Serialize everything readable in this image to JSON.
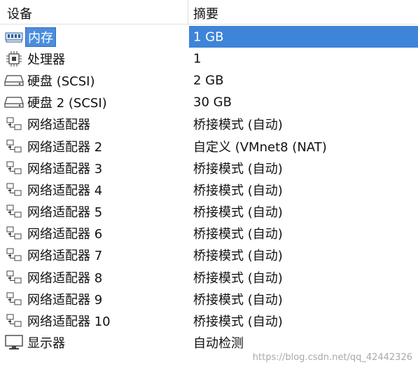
{
  "header": {
    "device_col": "设备",
    "summary_col": "摘要"
  },
  "devices": [
    {
      "icon": "memory-icon",
      "label": "内存",
      "summary": "1 GB",
      "selected": true
    },
    {
      "icon": "processor-icon",
      "label": "处理器",
      "summary": "1"
    },
    {
      "icon": "hard-disk-icon",
      "label": "硬盘 (SCSI)",
      "summary": "2 GB"
    },
    {
      "icon": "hard-disk-icon",
      "label": "硬盘 2 (SCSI)",
      "summary": "30 GB"
    },
    {
      "icon": "network-adapter-icon",
      "label": "网络适配器",
      "summary": "桥接模式 (自动)"
    },
    {
      "icon": "network-adapter-icon",
      "label": "网络适配器 2",
      "summary": "自定义 (VMnet8 (NAT)"
    },
    {
      "icon": "network-adapter-icon",
      "label": "网络适配器 3",
      "summary": "桥接模式 (自动)"
    },
    {
      "icon": "network-adapter-icon",
      "label": "网络适配器 4",
      "summary": "桥接模式 (自动)"
    },
    {
      "icon": "network-adapter-icon",
      "label": "网络适配器 5",
      "summary": "桥接模式 (自动)"
    },
    {
      "icon": "network-adapter-icon",
      "label": "网络适配器 6",
      "summary": "桥接模式 (自动)"
    },
    {
      "icon": "network-adapter-icon",
      "label": "网络适配器 7",
      "summary": "桥接模式 (自动)"
    },
    {
      "icon": "network-adapter-icon",
      "label": "网络适配器 8",
      "summary": "桥接模式 (自动)"
    },
    {
      "icon": "network-adapter-icon",
      "label": "网络适配器 9",
      "summary": "桥接模式 (自动)"
    },
    {
      "icon": "network-adapter-icon",
      "label": "网络适配器 10",
      "summary": "桥接模式 (自动)"
    },
    {
      "icon": "display-icon",
      "label": "显示器",
      "summary": "自动检测"
    }
  ],
  "watermark": "https://blog.csdn.net/qq_42442326",
  "colors": {
    "selection": "#3e84d8",
    "text": "#111111"
  }
}
